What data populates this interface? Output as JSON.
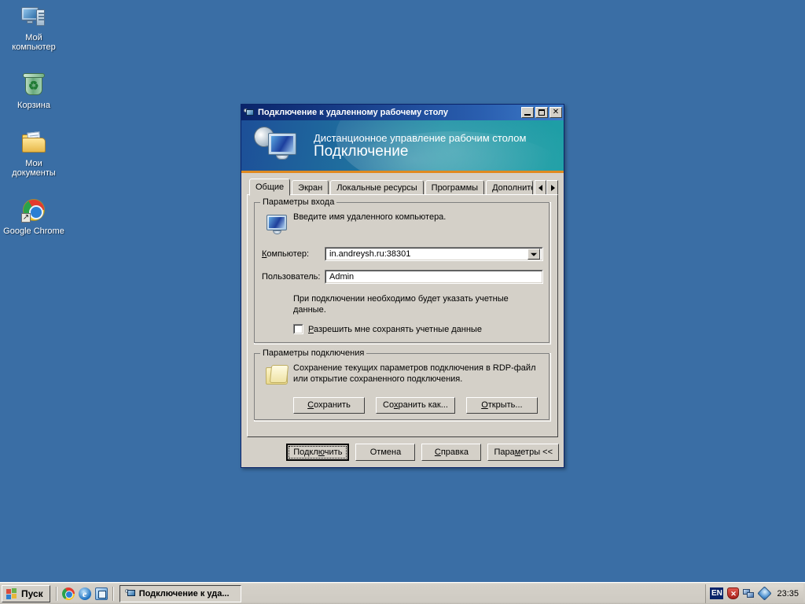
{
  "desktop": {
    "background_color": "#3a6ea5",
    "icons": [
      {
        "name": "my-computer",
        "label": "Мой\nкомпьютер",
        "icon": "computer-icon"
      },
      {
        "name": "recycle-bin",
        "label": "Корзина",
        "icon": "recycle-bin-icon"
      },
      {
        "name": "my-documents",
        "label": "Мои\nдокументы",
        "icon": "documents-folder-icon"
      },
      {
        "name": "google-chrome",
        "label": "Google Chrome",
        "icon": "chrome-icon"
      }
    ]
  },
  "window": {
    "title": "Подключение к удаленному рабочему столу",
    "title_icon": "remote-desktop-icon",
    "titlebar_color": "#0a246a",
    "controls": {
      "minimize": "_",
      "maximize": "❐",
      "close": "✕"
    },
    "banner": {
      "subtitle": "Дистанционное управление рабочим столом",
      "title": "Подключение",
      "accent_color": "#e08a20",
      "icon": "remote-desktop-banner-icon"
    },
    "tabs": [
      {
        "label": "Общие",
        "active": true
      },
      {
        "label": "Экран",
        "active": false
      },
      {
        "label": "Локальные ресурсы",
        "active": false
      },
      {
        "label": "Программы",
        "active": false
      },
      {
        "label": "Дополнительно",
        "active": false,
        "clipped": true
      }
    ],
    "tab_scroll": {
      "left": "◀",
      "right": "▶"
    },
    "logon_group": {
      "legend": "Параметры входа",
      "icon": "monitor-icon",
      "description": "Введите имя удаленного компьютера.",
      "computer_label": "Компьютер:",
      "computer_label_accel": "К",
      "computer_value": "in.andreysh.ru:38301",
      "user_label": "Пользователь:",
      "user_value": "Admin",
      "credentials_note": "При подключении необходимо будет указать учетные\nданные.",
      "save_credentials_label": "Разрешить мне сохранять учетные данные",
      "save_credentials_accel": "Р",
      "save_credentials_checked": false
    },
    "connection_group": {
      "legend": "Параметры подключения",
      "icon": "folder-icon",
      "description": "Сохранение текущих параметров подключения в\nRDP-файл или открытие сохраненного подключения.",
      "buttons": [
        {
          "name": "save-button",
          "label": "Сохранить",
          "accel": "С"
        },
        {
          "name": "save-as-button",
          "label": "Сохранить как...",
          "accel": "х"
        },
        {
          "name": "open-button",
          "label": "Открыть...",
          "accel": "О"
        }
      ]
    },
    "footer_buttons": [
      {
        "name": "connect-button",
        "label": "Подключить",
        "accel": "ю",
        "default": true
      },
      {
        "name": "cancel-button",
        "label": "Отмена",
        "default": false
      },
      {
        "name": "help-button",
        "label": "Справка",
        "accel": "С",
        "default": false
      },
      {
        "name": "options-button",
        "label": "Параметры <<",
        "accel": "е",
        "default": false
      }
    ]
  },
  "taskbar": {
    "start_label": "Пуск",
    "quicklaunch": [
      {
        "name": "chrome",
        "icon": "chrome-icon"
      },
      {
        "name": "internet-explorer",
        "icon": "internet-explorer-icon",
        "glyph": "e"
      },
      {
        "name": "show-desktop",
        "icon": "show-desktop-icon"
      }
    ],
    "tasks": [
      {
        "label": "Подключение к уда...",
        "icon": "remote-desktop-icon",
        "active": true
      }
    ],
    "tray": {
      "language": "EN",
      "icons": [
        {
          "name": "security-alert",
          "icon": "shield-icon"
        },
        {
          "name": "network",
          "icon": "network-icon"
        },
        {
          "name": "vm-tools",
          "icon": "vm-tools-icon"
        }
      ],
      "clock": "23:35"
    }
  }
}
